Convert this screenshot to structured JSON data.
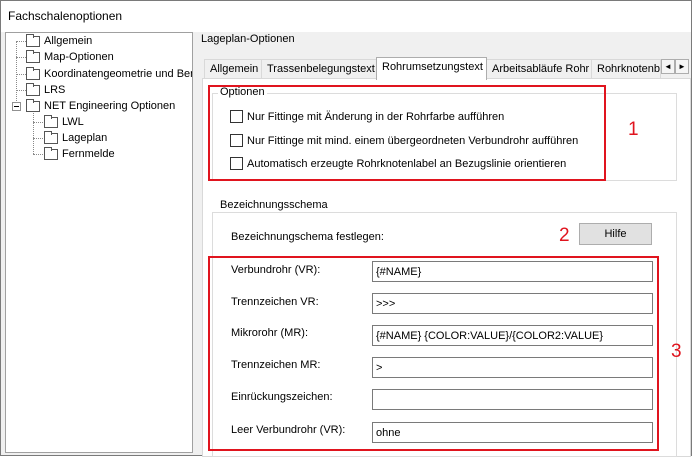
{
  "window": {
    "title": "Fachschalenoptionen"
  },
  "tree": {
    "items": [
      {
        "label": "Allgemein"
      },
      {
        "label": "Map-Optionen"
      },
      {
        "label": "Koordinatengeometrie und Berr"
      },
      {
        "label": "LRS"
      },
      {
        "label": "NET Engineering Optionen"
      },
      {
        "label": "LWL"
      },
      {
        "label": "Lageplan"
      },
      {
        "label": "Fernmelde"
      }
    ]
  },
  "panel": {
    "group_label": "Lageplan-Optionen",
    "tabs": [
      {
        "label": "Allgemein"
      },
      {
        "label": "Trassenbelegungstext"
      },
      {
        "label": "Rohrumsetzungstext"
      },
      {
        "label": "Arbeitsabläufe Rohr"
      },
      {
        "label": "Rohrknotenb"
      }
    ],
    "active_tab": "Rohrumsetzungstext",
    "scroll_left": "◄",
    "scroll_right": "►"
  },
  "options": {
    "legend": "Optionen",
    "checkboxes": [
      {
        "label": "Nur Fittinge mit Änderung in der Rohrfarbe aufführen",
        "checked": false
      },
      {
        "label": "Nur Fittinge mit mind. einem übergeordneten Verbundrohr aufführen",
        "checked": false
      },
      {
        "label": "Automatisch erzeugte Rohrknotenlabel an Bezugslinie orientieren",
        "checked": false
      }
    ]
  },
  "naming": {
    "legend": "Bezeichnungsschema",
    "define_label": "Bezeichnungschema festlegen:",
    "help_button": "Hilfe",
    "fields": [
      {
        "label": "Verbundrohr (VR):",
        "value": "{#NAME}"
      },
      {
        "label": "Trennzeichen VR:",
        "value": ">>>"
      },
      {
        "label": "Mikrorohr (MR):",
        "value": "{#NAME} {COLOR:VALUE}/{COLOR2:VALUE}"
      },
      {
        "label": "Trennzeichen MR:",
        "value": ">"
      },
      {
        "label": "Einrückungszeichen:",
        "value": ""
      },
      {
        "label": "Leer Verbundrohr (VR):",
        "value": "ohne"
      }
    ]
  },
  "annotations": {
    "one": "1",
    "two": "2",
    "three": "3"
  },
  "colors": {
    "highlight": "#e0141e",
    "window_bg": "#f0f0f0",
    "panel_bg": "#ffffff"
  }
}
